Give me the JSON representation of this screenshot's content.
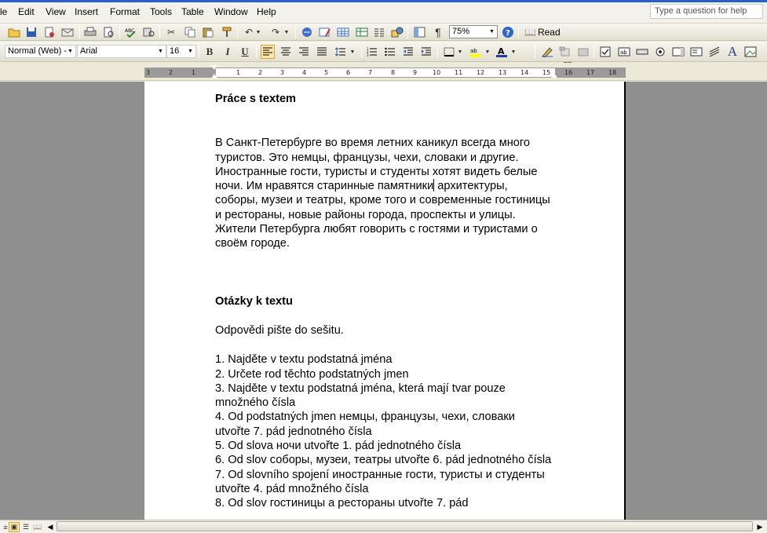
{
  "menu": {
    "items": [
      "File",
      "Edit",
      "View",
      "Insert",
      "Format",
      "Tools",
      "Table",
      "Window",
      "Help"
    ],
    "file_visible": "le",
    "help_placeholder": "Type a question for help"
  },
  "toolbar": {
    "zoom": "75%",
    "read_label": "Read",
    "style": "Normal (Web) -",
    "font": "Arial",
    "size": "16",
    "bold": "B",
    "italic": "I",
    "underline": "U",
    "pilcrow": "¶"
  },
  "ruler": {
    "labels": [
      "3",
      "2",
      "1",
      "1",
      "2",
      "3",
      "4",
      "5",
      "6",
      "7",
      "8",
      "9",
      "10",
      "11",
      "12",
      "13",
      "14",
      "15",
      "16",
      "17",
      "18"
    ]
  },
  "document": {
    "heading1": "Práce s textem",
    "paragraph_before_caret": "В Санкт-Петербурге во время летних каникул всегда много туристов. Это немцы, французы, чехи, словаки и другие. Иностранные гости, туристы и студенты хотят видеть белые ночи. Им нравятся старинные памятники",
    "paragraph_after_caret": " архитектуры, соборы, музеи и театры, кроме того и современные гостиницы и рестораны, новые районы города, проспекты и улицы. Жители Петербурга любят говорить с гостями и туристами о своём городе.",
    "heading2": "Otázky k textu",
    "instruction": "Odpovědi pište do sešitu.",
    "questions": [
      "1. Najděte v textu podstatná jména",
      "2. Určete rod těchto podstatných jmen",
      "3. Najděte v textu podstatná jména, která mají tvar pouze množného čísla",
      "4. Od podstatných jmen немцы, французы, чехи, словаки utvořte 7. pád jednotného čísla",
      "5. Od slova ночи utvořte 1. pád jednotného čísla",
      "6. Od slov соборы, музеи, театры utvořte 6. pád jednotného čísla",
      "7. Od slovního spojení иностранные гости, туристы и студенты utvořte 4. pád množného čísla",
      "8. Od slov гостиницы а рестораны utvořte 7. pád"
    ]
  }
}
